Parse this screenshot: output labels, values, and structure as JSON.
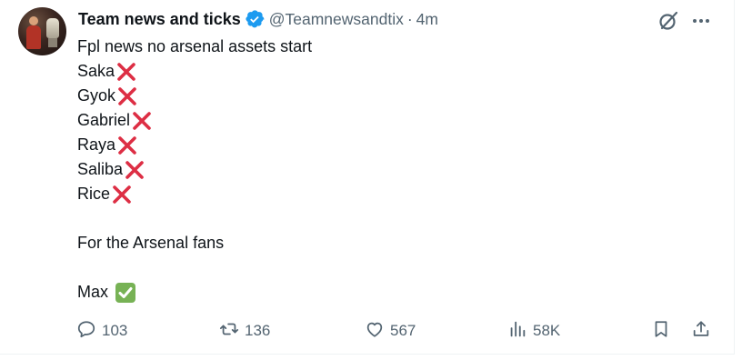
{
  "author": {
    "display_name": "Team news and ticks",
    "handle": "@Teamnewsandtix",
    "separator": "·",
    "time": "4m",
    "verified": true,
    "verified_color": "#1d9bf0"
  },
  "tweet": {
    "intro": "Fpl news no arsenal assets start",
    "players": [
      {
        "name": "Saka",
        "status": "cross-mark"
      },
      {
        "name": "Gyok",
        "status": "cross-mark"
      },
      {
        "name": "Gabriel",
        "status": "cross-mark"
      },
      {
        "name": "Raya",
        "status": "cross-mark"
      },
      {
        "name": "Saliba",
        "status": "cross-mark"
      },
      {
        "name": "Rice",
        "status": "cross-mark"
      }
    ],
    "fans_line": "For the Arsenal fans",
    "signoff": "Max",
    "signoff_emoji": "check-mark-button"
  },
  "metrics": {
    "replies": "103",
    "reposts": "136",
    "likes": "567",
    "views": "58K"
  },
  "icons": {
    "top_right": [
      "grok-icon",
      "more-icon"
    ],
    "actions": [
      "reply-icon",
      "repost-icon",
      "like-icon",
      "views-icon",
      "bookmark-icon",
      "share-icon"
    ]
  },
  "colors": {
    "text_primary": "#0f1419",
    "text_secondary": "#536471",
    "cross_mark": "#dd2e44",
    "check_mark": "#77b255"
  }
}
